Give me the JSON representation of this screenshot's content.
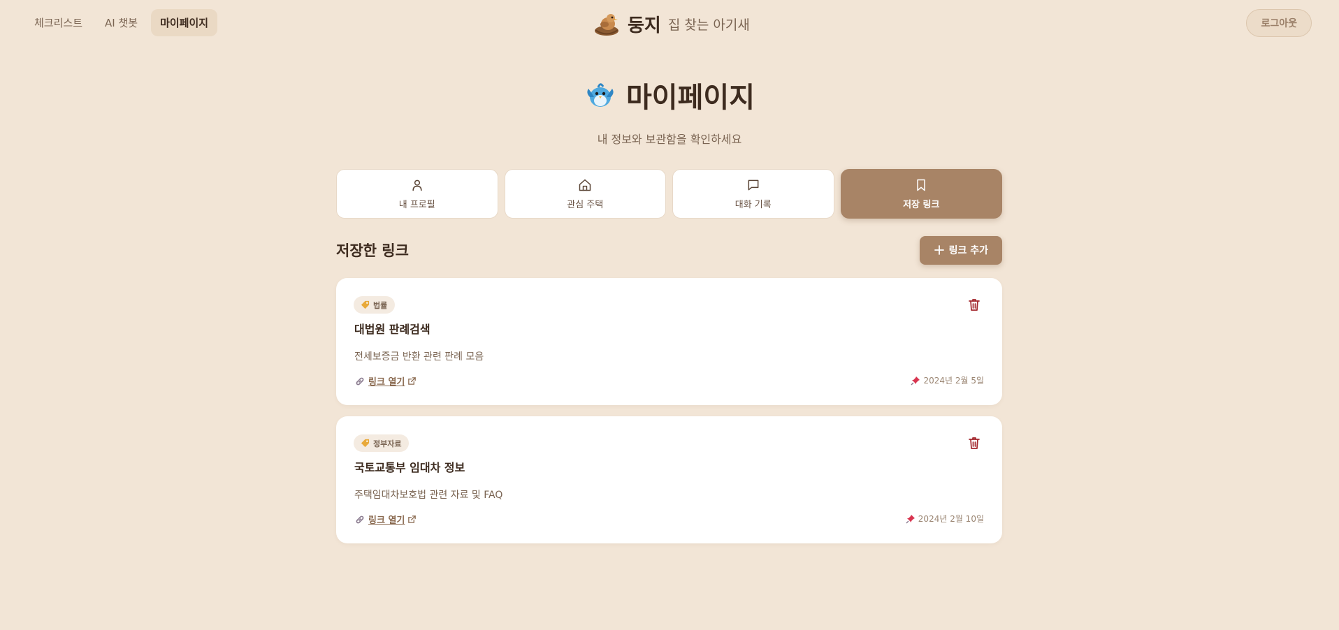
{
  "nav": {
    "links": [
      {
        "label": "체크리스트"
      },
      {
        "label": "AI 챗봇"
      },
      {
        "label": "마이페이지",
        "active": true
      }
    ],
    "brand_name": "둥지",
    "brand_tagline": "집 찾는 아기새",
    "brand_icon": "bird-in-nest-icon",
    "logout_label": "로그아웃"
  },
  "hero": {
    "icon": "blue-bird-icon",
    "title": "마이페이지",
    "subtitle": "내 정보와 보관함을 확인하세요"
  },
  "tabs": [
    {
      "label": "내 프로필",
      "icon": "user-icon"
    },
    {
      "label": "관심 주택",
      "icon": "home-icon"
    },
    {
      "label": "대화 기록",
      "icon": "chat-icon"
    },
    {
      "label": "저장 링크",
      "icon": "bookmark-icon",
      "active": true
    }
  ],
  "section": {
    "title": "저장한 링크",
    "add_label": "링크 추가"
  },
  "links": [
    {
      "category": "법률",
      "title": "대법원 판례검색",
      "description": "전세보증금 반환 관련 판례 모음",
      "open_label": "링크 열기",
      "date": "2024년 2월 5일"
    },
    {
      "category": "정부자료",
      "title": "국토교통부 임대차 정보",
      "description": "주택임대차보호법 관련 자료 및 FAQ",
      "open_label": "링크 열기",
      "date": "2024년 2월 10일"
    }
  ],
  "colors": {
    "background": "#f2e5d6",
    "accent": "#a88466",
    "trash": "#a3262c",
    "pin": "#d8344f"
  }
}
